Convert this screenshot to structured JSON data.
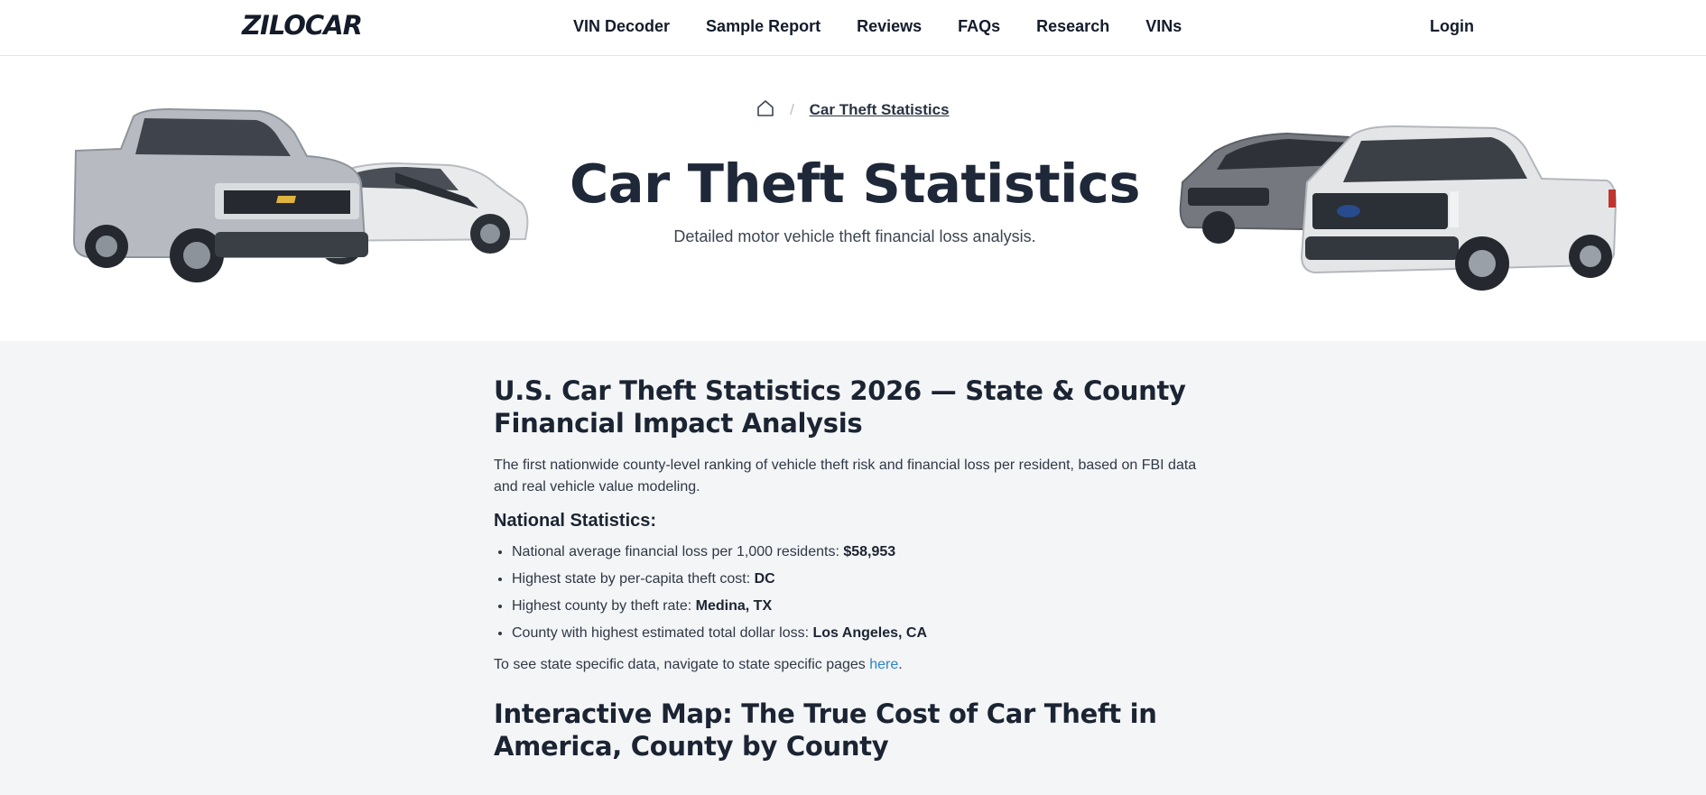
{
  "brand": {
    "logo": "ZILOCAR"
  },
  "nav": {
    "items": [
      "VIN Decoder",
      "Sample Report",
      "Reviews",
      "FAQs",
      "Research",
      "VINs"
    ],
    "login": "Login"
  },
  "hero": {
    "breadcrumb": {
      "home_icon": "home-icon",
      "current": "Car Theft Statistics"
    },
    "title": "Car Theft Statistics",
    "subtitle": "Detailed motor vehicle theft financial loss analysis."
  },
  "article": {
    "heading": "U.S. Car Theft Statistics 2026 — State & County Financial Impact Analysis",
    "intro": "The first nationwide county-level ranking of vehicle theft risk and financial loss per resident, based on FBI data and real vehicle value modeling.",
    "stats_heading": "National Statistics:",
    "stats": [
      {
        "label": "National average financial loss per 1,000 residents: ",
        "value": "$58,953"
      },
      {
        "label": "Highest state by per-capita theft cost: ",
        "value": "DC"
      },
      {
        "label": "Highest county by theft rate: ",
        "value": "Medina, TX"
      },
      {
        "label": "County with highest estimated total dollar loss: ",
        "value": "Los Angeles, CA"
      }
    ],
    "state_note_prefix": "To see state specific data, navigate to state specific pages ",
    "state_note_link": "here",
    "state_note_suffix": ".",
    "map_heading": "Interactive Map: The True Cost of Car Theft in America, County by County"
  },
  "colors": {
    "link": "#2c84c8",
    "text": "#1b2432",
    "band": "#f4f5f7"
  }
}
